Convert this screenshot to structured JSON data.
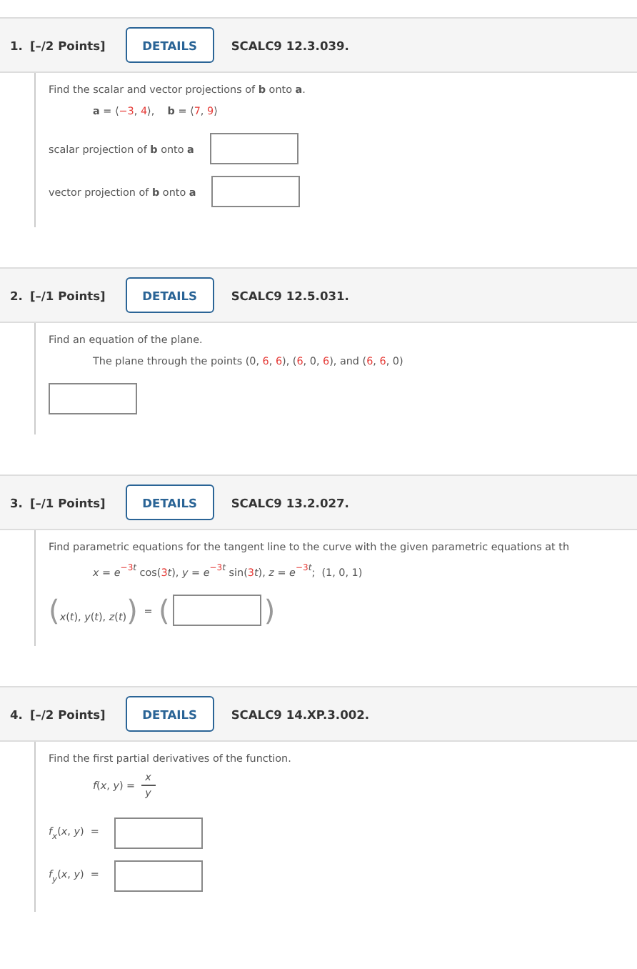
{
  "questions": [
    {
      "number": "1.",
      "points": "[–/2 Points]",
      "details": "DETAILS",
      "code": "SCALC9 12.3.039.",
      "prompt": "Find the scalar and vector projections of **b** onto **a**.",
      "math": [
        {
          "kind": "line",
          "segs": [
            {
              "t": "a",
              "b": true
            },
            {
              "t": " = ⟨"
            },
            {
              "t": "−3",
              "red": true
            },
            {
              "t": ", "
            },
            {
              "t": "4",
              "red": true
            },
            {
              "t": "⟩,    "
            },
            {
              "t": "b",
              "b": true
            },
            {
              "t": " = ⟨"
            },
            {
              "t": "7",
              "red": true
            },
            {
              "t": ", "
            },
            {
              "t": "9",
              "red": true
            },
            {
              "t": "⟩"
            }
          ]
        }
      ],
      "answers": [
        {
          "kind": "row",
          "label": [
            {
              "t": "scalar projection of "
            },
            {
              "t": "b",
              "b": true
            },
            {
              "t": " onto "
            },
            {
              "t": "a",
              "b": true
            }
          ]
        },
        {
          "kind": "row",
          "label": [
            {
              "t": "vector projection of "
            },
            {
              "t": "b",
              "b": true
            },
            {
              "t": " onto "
            },
            {
              "t": "a",
              "b": true
            }
          ]
        }
      ]
    },
    {
      "number": "2.",
      "points": "[–/1 Points]",
      "details": "DETAILS",
      "code": "SCALC9 12.5.031.",
      "prompt": "Find an equation of the plane.",
      "math": [
        {
          "kind": "line",
          "segs": [
            {
              "t": "The plane through the points (0, "
            },
            {
              "t": "6",
              "red": true
            },
            {
              "t": ", "
            },
            {
              "t": "6",
              "red": true
            },
            {
              "t": "), ("
            },
            {
              "t": "6",
              "red": true
            },
            {
              "t": ", 0, "
            },
            {
              "t": "6",
              "red": true
            },
            {
              "t": "), and ("
            },
            {
              "t": "6",
              "red": true
            },
            {
              "t": ", "
            },
            {
              "t": "6",
              "red": true
            },
            {
              "t": ", 0)"
            }
          ]
        }
      ],
      "answers": [
        {
          "kind": "field"
        }
      ]
    },
    {
      "number": "3.",
      "points": "[–/1 Points]",
      "details": "DETAILS",
      "code": "SCALC9 13.2.027.",
      "prompt": "Find parametric equations for the tangent line to the curve with the given parametric equations at th",
      "math": [
        {
          "kind": "line",
          "segs": [
            {
              "t": "x",
              "it": true
            },
            {
              "t": " = "
            },
            {
              "t": "e",
              "it": true
            },
            {
              "t": "−3",
              "sup": true,
              "red": true
            },
            {
              "t": "t",
              "sup": true,
              "it": true
            },
            {
              "t": " cos("
            },
            {
              "t": "3",
              "red": true
            },
            {
              "t": "t",
              "it": true
            },
            {
              "t": "), "
            },
            {
              "t": "y",
              "it": true
            },
            {
              "t": " = "
            },
            {
              "t": "e",
              "it": true
            },
            {
              "t": "−3",
              "sup": true,
              "red": true
            },
            {
              "t": "t",
              "sup": true,
              "it": true
            },
            {
              "t": " sin("
            },
            {
              "t": "3",
              "red": true
            },
            {
              "t": "t",
              "it": true
            },
            {
              "t": "), "
            },
            {
              "t": "z",
              "it": true
            },
            {
              "t": " = "
            },
            {
              "t": "e",
              "it": true
            },
            {
              "t": "−3",
              "sup": true,
              "red": true
            },
            {
              "t": "t",
              "sup": true,
              "it": true
            },
            {
              "t": ";  (1, 0, 1)"
            }
          ]
        }
      ],
      "answers": [
        {
          "kind": "tuple",
          "open": "(",
          "close": ")",
          "label": [
            {
              "t": "x",
              "it": true
            },
            {
              "t": "("
            },
            {
              "t": "t",
              "it": true
            },
            {
              "t": "), "
            },
            {
              "t": "y",
              "it": true
            },
            {
              "t": "("
            },
            {
              "t": "t",
              "it": true
            },
            {
              "t": "), "
            },
            {
              "t": "z",
              "it": true
            },
            {
              "t": "("
            },
            {
              "t": "t",
              "it": true
            },
            {
              "t": ")"
            }
          ],
          "equals": "=",
          "open2": "(",
          "close2": ")"
        }
      ]
    },
    {
      "number": "4.",
      "points": "[–/2 Points]",
      "details": "DETAILS",
      "code": "SCALC9 14.XP.3.002.",
      "prompt": "Find the first partial derivatives of the function.",
      "math": [
        {
          "kind": "fraction",
          "segs": [
            {
              "t": "f",
              "it": true
            },
            {
              "t": "("
            },
            {
              "t": "x",
              "it": true
            },
            {
              "t": ", "
            },
            {
              "t": "y",
              "it": true
            },
            {
              "t": ") ="
            }
          ],
          "num": "x",
          "den": "y"
        }
      ],
      "answers": [
        {
          "kind": "row",
          "label": [
            {
              "t": "f",
              "it": true
            },
            {
              "t": "x",
              "it": true,
              "sub": true
            },
            {
              "t": "("
            },
            {
              "t": "x",
              "it": true
            },
            {
              "t": ", "
            },
            {
              "t": "y",
              "it": true
            },
            {
              "t": ")  ="
            }
          ]
        },
        {
          "kind": "row",
          "label": [
            {
              "t": "f",
              "it": true
            },
            {
              "t": "y",
              "it": true,
              "sub": true
            },
            {
              "t": "("
            },
            {
              "t": "x",
              "it": true
            },
            {
              "t": ", "
            },
            {
              "t": "y",
              "it": true
            },
            {
              "t": ")  ="
            }
          ]
        }
      ]
    }
  ]
}
